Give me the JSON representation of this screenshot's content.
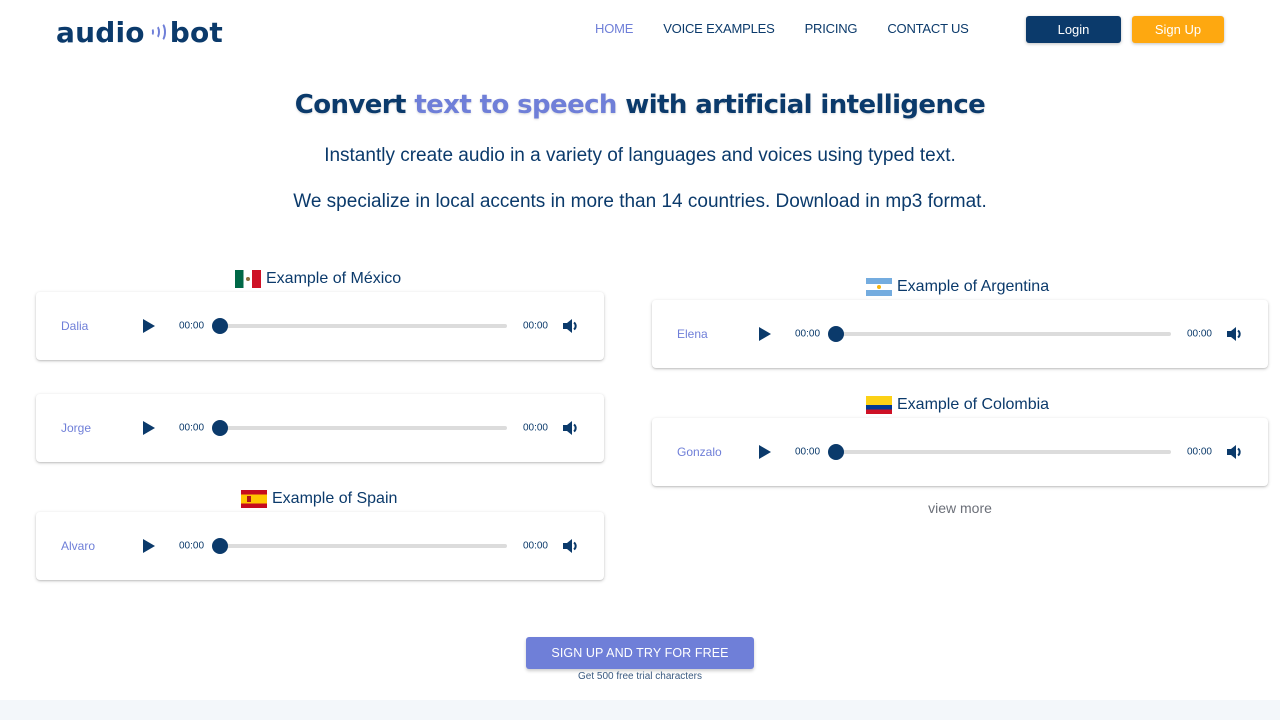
{
  "brand": {
    "name_left": "audio",
    "name_right": "bot",
    "icon": "sound-waves-icon"
  },
  "nav": {
    "items": [
      {
        "label": "HOME",
        "active": true
      },
      {
        "label": "VOICE EXAMPLES",
        "active": false
      },
      {
        "label": "PRICING",
        "active": false
      },
      {
        "label": "CONTACT US",
        "active": false
      }
    ],
    "login_label": "Login",
    "signup_label": "Sign Up"
  },
  "hero": {
    "title_part1": "Convert ",
    "title_accent": "text to speech",
    "title_part2": " with artificial intelligence",
    "subtitle1": "Instantly create audio in a variety of languages and voices using typed text.",
    "subtitle2": "We specialize in local accents in more than 14 countries. Download in mp3 format."
  },
  "examples": {
    "mexico": {
      "label": "Example of México",
      "flag": "mexico-flag",
      "players": [
        {
          "voice": "Dalia",
          "current_time": "00:00",
          "duration": "00:00",
          "progress": 0
        },
        {
          "voice": "Jorge",
          "current_time": "00:00",
          "duration": "00:00",
          "progress": 0
        }
      ]
    },
    "spain": {
      "label": "Example of Spain",
      "flag": "spain-flag",
      "players": [
        {
          "voice": "Alvaro",
          "current_time": "00:00",
          "duration": "00:00",
          "progress": 0
        }
      ]
    },
    "argentina": {
      "label": "Example of Argentina",
      "flag": "argentina-flag",
      "players": [
        {
          "voice": "Elena",
          "current_time": "00:00",
          "duration": "00:00",
          "progress": 0
        }
      ]
    },
    "colombia": {
      "label": "Example of Colombia",
      "flag": "colombia-flag",
      "players": [
        {
          "voice": "Gonzalo",
          "current_time": "00:00",
          "duration": "00:00",
          "progress": 0
        }
      ]
    },
    "view_more_label": "view more"
  },
  "cta": {
    "button_label": "SIGN UP AND TRY FOR FREE",
    "note": "Get 500 free trial characters"
  },
  "colors": {
    "primary": "#0b3a6b",
    "accent": "#6f7fd8",
    "signup": "#fea810"
  }
}
